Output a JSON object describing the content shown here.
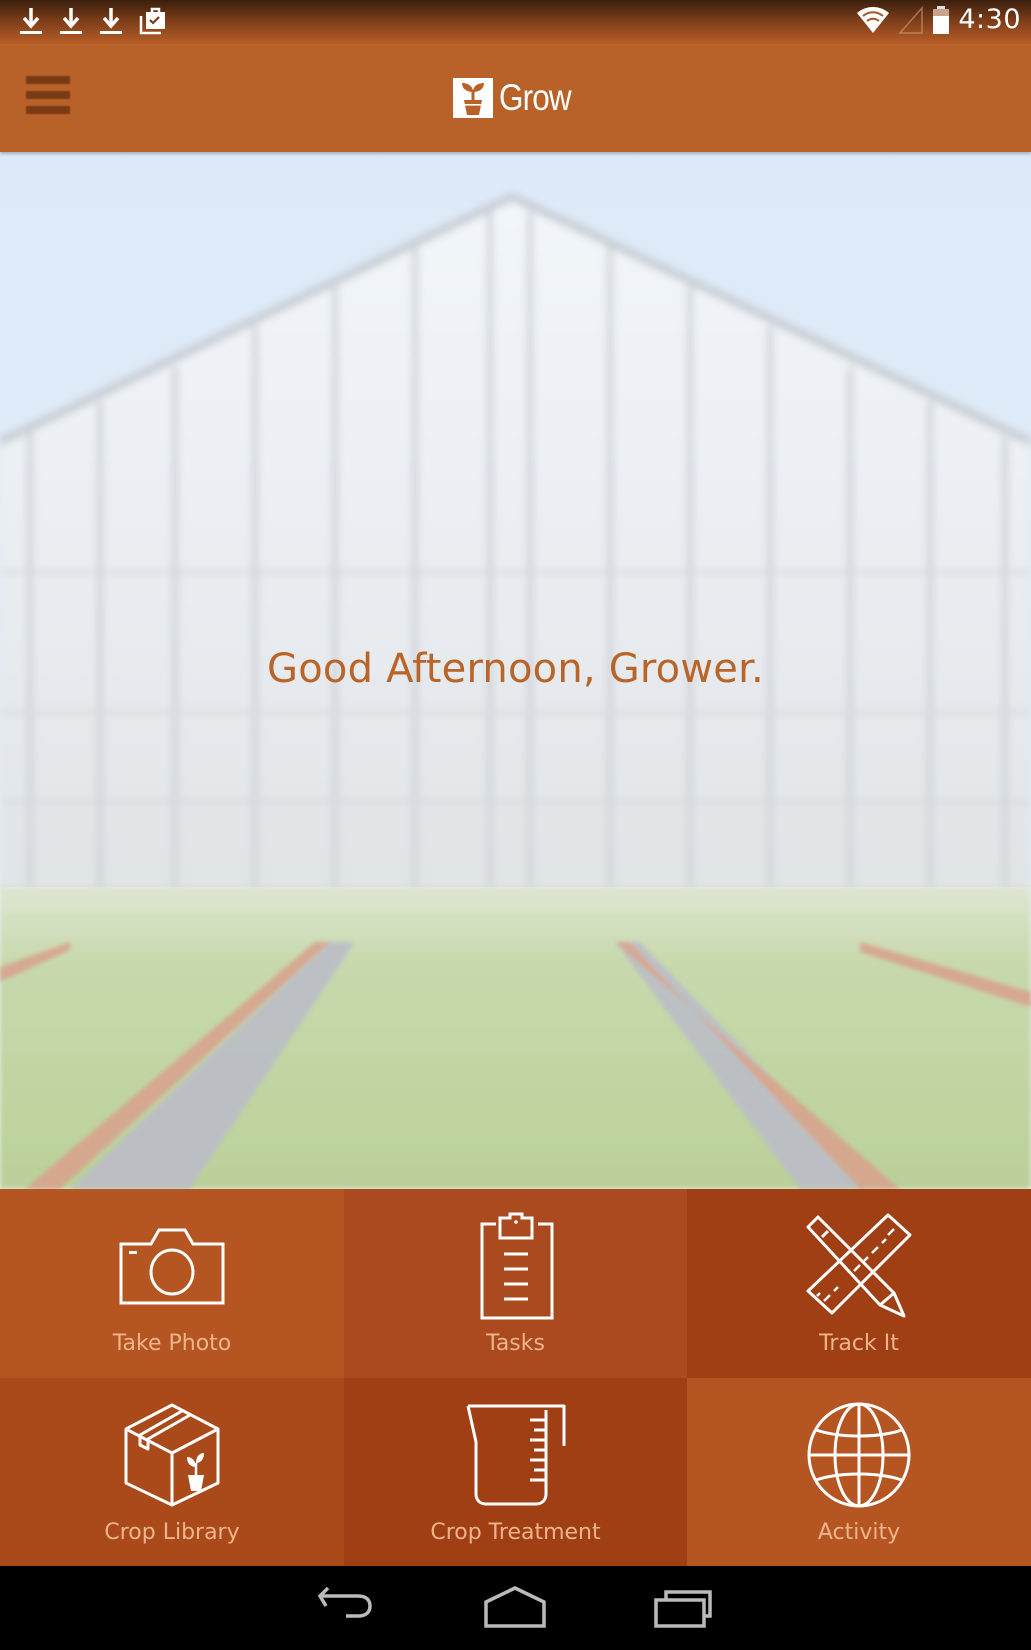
{
  "status_bar": {
    "notifications": [
      "download-icon",
      "download-icon",
      "download-icon",
      "shopping-bag-check-icon"
    ],
    "wifi": "wifi-icon",
    "signal": "cell-signal-empty-icon",
    "battery": "battery-icon",
    "time": "4:30"
  },
  "app_bar": {
    "menu_icon": "hamburger-menu-icon",
    "logo_text": "Grow",
    "logo_icon": "plant-pot-icon"
  },
  "hero": {
    "greeting": "Good Afternoon, Grower.",
    "background": "greenhouse-photo"
  },
  "tiles": [
    {
      "label": "Take Photo",
      "icon": "camera-icon",
      "color": "#b55522"
    },
    {
      "label": "Tasks",
      "icon": "clipboard-icon",
      "color": "#aa4a1e"
    },
    {
      "label": "Track It",
      "icon": "pencil-ruler-icon",
      "color": "#a03e14"
    },
    {
      "label": "Crop Library",
      "icon": "box-plant-icon",
      "color": "#aa4a1a"
    },
    {
      "label": "Crop Treatment",
      "icon": "measuring-beaker-icon",
      "color": "#a03e14"
    },
    {
      "label": "Activity",
      "icon": "globe-icon",
      "color": "#b55522"
    }
  ],
  "nav_bar": {
    "back": "back-icon",
    "home": "home-icon",
    "recents": "recent-apps-icon"
  },
  "colors": {
    "app_bar": "#b86128",
    "greeting_text": "#b9652a",
    "tile_label": "#f0b48c"
  }
}
